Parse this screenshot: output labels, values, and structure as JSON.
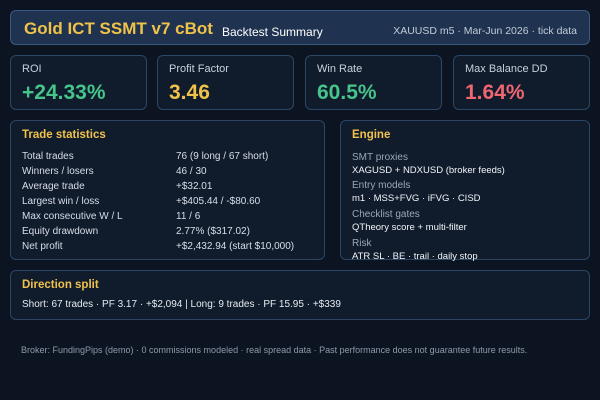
{
  "header": {
    "title": "Gold ICT SSMT v7 cBot",
    "subtitle": "Backtest Summary",
    "meta": "XAUUSD m5 · Mar-Jun 2026 · tick data"
  },
  "metrics": [
    {
      "label": "ROI",
      "value": "+24.33%",
      "color": "#46c48a"
    },
    {
      "label": "Profit Factor",
      "value": "3.46",
      "color": "#f0c24a"
    },
    {
      "label": "Win Rate",
      "value": "60.5%",
      "color": "#46c48a"
    },
    {
      "label": "Max Balance DD",
      "value": "1.64%",
      "color": "#ee6670"
    }
  ],
  "stats": {
    "title": "Trade statistics",
    "rows": [
      {
        "label": "Total trades",
        "value": "76  (9 long / 67 short)"
      },
      {
        "label": "Winners / losers",
        "value": "46 / 30"
      },
      {
        "label": "Average trade",
        "value": "+$32.01"
      },
      {
        "label": "Largest win / loss",
        "value": "+$405.44 / -$80.60"
      },
      {
        "label": "Max consecutive W / L",
        "value": "11 / 6"
      },
      {
        "label": "Equity drawdown",
        "value": "2.77%  ($317.02)"
      },
      {
        "label": "Net profit",
        "value": "+$2,432.94  (start $10,000)"
      }
    ]
  },
  "engine": {
    "title": "Engine",
    "items": [
      {
        "heading": "SMT proxies",
        "value": "XAGUSD + NDXUSD (broker feeds)"
      },
      {
        "heading": "Entry models",
        "value": "m1 · MSS+FVG · iFVG · CISD"
      },
      {
        "heading": "Checklist gates",
        "value": "QTheory score + multi-filter"
      },
      {
        "heading": "Risk",
        "value": "ATR SL · BE · trail · daily stop"
      }
    ]
  },
  "direction": {
    "title": "Direction split",
    "line": "Short: 67 trades · PF 3.17 · +$2,094  |  Long: 9 trades · PF 15.95 · +$339"
  },
  "footer": "Broker: FundingPips (demo) · 0 commissions modeled · real spread data · Past performance does not guarantee future results."
}
